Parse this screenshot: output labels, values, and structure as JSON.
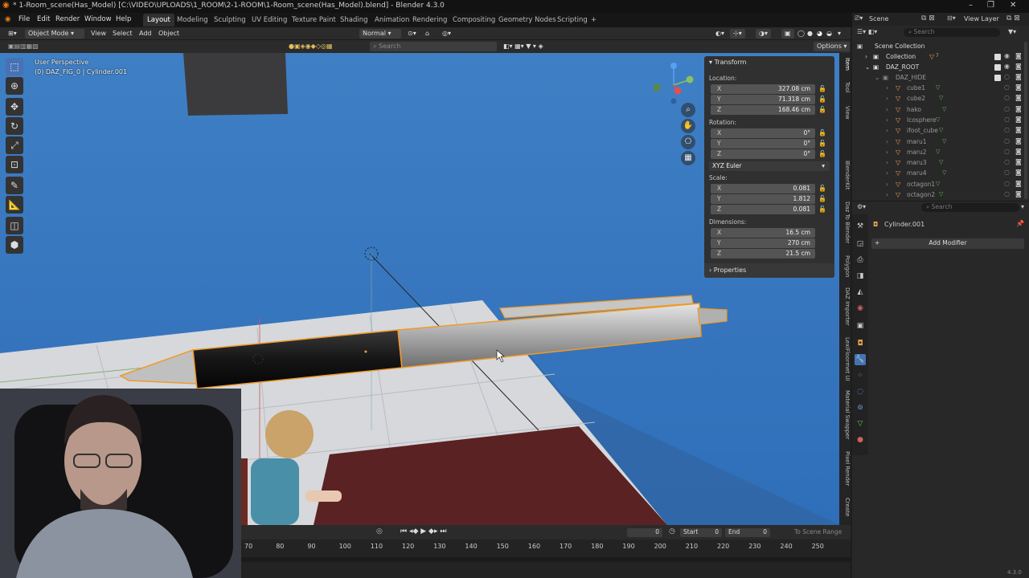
{
  "window": {
    "title": "* 1-Room_scene(Has_Model) [C:\\VIDEO\\UPLOADS\\1_ROOM\\2-1-ROOM\\1-Room_scene(Has_Model).blend] - Blender 4.3.0",
    "minimize": "–",
    "maximize": "❐",
    "close": "✕"
  },
  "menu": {
    "file": "File",
    "edit": "Edit",
    "render": "Render",
    "window": "Window",
    "help": "Help"
  },
  "workspaces": [
    "Layout",
    "Modeling",
    "Sculpting",
    "UV Editing",
    "Texture Paint",
    "Shading",
    "Animation",
    "Rendering",
    "Compositing",
    "Geometry Nodes",
    "Scripting"
  ],
  "workspace_add": "+",
  "scene": {
    "label": "Scene",
    "viewlayer": "View Layer"
  },
  "header": {
    "mode": "Object Mode",
    "view": "View",
    "select": "Select",
    "add": "Add",
    "object": "Object",
    "orientation": "Normal",
    "options": "Options",
    "search_placeholder": "Search"
  },
  "overlay": {
    "view": "User Perspective",
    "object": "(0) DAZ_FIG_0 | Cylinder.001"
  },
  "npanel": {
    "transform": "Transform",
    "location": {
      "label": "Location:",
      "x": "327.08 cm",
      "y": "71.318 cm",
      "z": "168.46 cm"
    },
    "rotation": {
      "label": "Rotation:",
      "x": "0°",
      "y": "0°",
      "z": "0°"
    },
    "rotation_mode": "XYZ Euler",
    "scale": {
      "label": "Scale:",
      "x": "0.081",
      "y": "1.812",
      "z": "0.081"
    },
    "dimensions": {
      "label": "Dimensions:",
      "x": "16.5 cm",
      "y": "270 cm",
      "z": "21.5 cm"
    },
    "properties": "Properties",
    "axes": {
      "x": "X",
      "y": "Y",
      "z": "Z"
    }
  },
  "sidetabs": [
    "Item",
    "Tool",
    "View",
    "BlenderKit",
    "Daz To Blender",
    "Polygon",
    "DAZ Importer",
    "LexiFloormet UI",
    "Material Swapper",
    "Pixel Render",
    "Create"
  ],
  "timeline": {
    "frame": "0",
    "start_label": "Start",
    "start": "0",
    "end_label": "End",
    "end": "0",
    "to_scene_range": "To Scene Range",
    "ticks": [
      "70",
      "80",
      "90",
      "100",
      "110",
      "120",
      "130",
      "140",
      "150",
      "160",
      "170",
      "180",
      "190",
      "200",
      "210",
      "220",
      "230",
      "240",
      "250"
    ]
  },
  "outliner": {
    "search_placeholder": "Search",
    "scene_collection": "Scene Collection",
    "rows": [
      {
        "name": "Collection",
        "badge": "7"
      },
      {
        "name": "DAZ_ROOT"
      },
      {
        "name": "DAZ_HIDE"
      },
      {
        "name": "cube1"
      },
      {
        "name": "cube2"
      },
      {
        "name": "hako"
      },
      {
        "name": "Icosphere"
      },
      {
        "name": "ifoot_cube"
      },
      {
        "name": "maru1"
      },
      {
        "name": "maru2"
      },
      {
        "name": "maru3"
      },
      {
        "name": "maru4"
      },
      {
        "name": "octagon1"
      },
      {
        "name": "octagon2"
      }
    ]
  },
  "properties": {
    "search_placeholder": "Search",
    "object_name": "Cylinder.001",
    "add_modifier": "Add Modifier"
  },
  "version": "4.3.0",
  "colors": {
    "accent": "#4772b3",
    "viewport_bg": "#3a7dc7",
    "selection": "#f09a2a",
    "panel": "#303030"
  }
}
